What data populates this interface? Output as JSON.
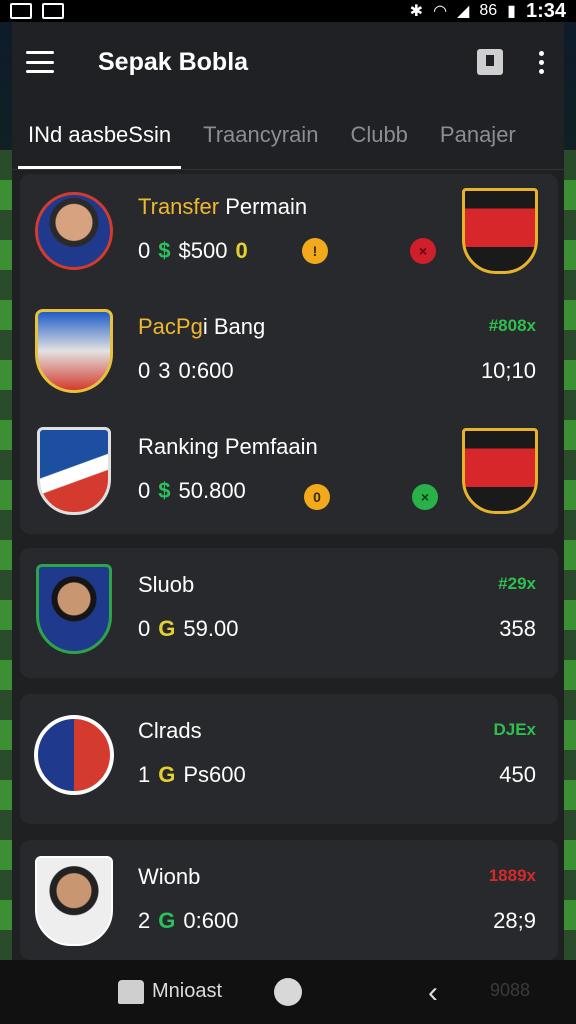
{
  "status_bar": {
    "time": "1:34",
    "signal_text": "86"
  },
  "app_bar": {
    "title": "Sepak Bobla"
  },
  "tabs": [
    {
      "label": "INd aasbeSsin"
    },
    {
      "label": "Traancyrain"
    },
    {
      "label": "Clubb"
    },
    {
      "label": "Panajer"
    }
  ],
  "rows": [
    {
      "title_highlight": "Transfer",
      "title_rest": " Permain",
      "stat_a": "0",
      "stat_icon": "$",
      "stat_b": "$500",
      "stat_c": "0",
      "tag": "",
      "right_value": ""
    },
    {
      "title_highlight": "PacPg",
      "title_rest": "i Bang",
      "stat_a": "0",
      "stat_icon": "3",
      "stat_b": "0:600",
      "stat_c": "",
      "tag": "#808x",
      "right_value": "10;10"
    },
    {
      "title_highlight": "",
      "title_rest": "Ranking Pemfaain",
      "stat_a": "0",
      "stat_icon": "$",
      "stat_b": "50.800",
      "stat_c": "",
      "tag": "",
      "right_value": ""
    },
    {
      "title_highlight": "",
      "title_rest": "Sluob",
      "stat_a": "0",
      "stat_icon": "G",
      "stat_b": "59.00",
      "stat_c": "",
      "tag": "#29x",
      "right_value": "358"
    },
    {
      "title_highlight": "",
      "title_rest": "Clrads",
      "stat_a": "1",
      "stat_icon": "G",
      "stat_b": "Ps600",
      "stat_c": "",
      "tag": "DJEx",
      "right_value": "450"
    },
    {
      "title_highlight": "",
      "title_rest": "Wionb",
      "stat_a": "2",
      "stat_icon": "G",
      "stat_b": "0:600",
      "stat_c": "",
      "tag": "1889x",
      "right_value": "28;9"
    }
  ],
  "nav_bar": {
    "label": "Mnioast",
    "ghost": "9088"
  },
  "colors": {
    "accent_green": "#29c15a",
    "accent_yellow": "#f0b72f",
    "accent_red": "#d52a2a"
  }
}
